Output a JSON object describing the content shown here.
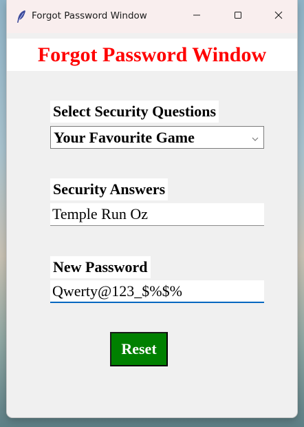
{
  "window": {
    "title": "Forgot Password Window",
    "app_icon": "feather-icon",
    "controls": {
      "minimize_icon": "minimize-icon",
      "maximize_icon": "maximize-icon",
      "close_icon": "close-icon"
    }
  },
  "banner": {
    "text": "Forgot Password Window",
    "color": "#ff0000"
  },
  "form": {
    "security_question": {
      "label": "Select Security Questions",
      "selected": "Your Favourite Game"
    },
    "security_answer": {
      "label": "Security Answers",
      "value": "Temple Run Oz"
    },
    "new_password": {
      "label": "New Password",
      "value": "Qwerty@123_$%$%"
    },
    "reset_button": {
      "label": "Reset",
      "color": "#008000"
    }
  }
}
